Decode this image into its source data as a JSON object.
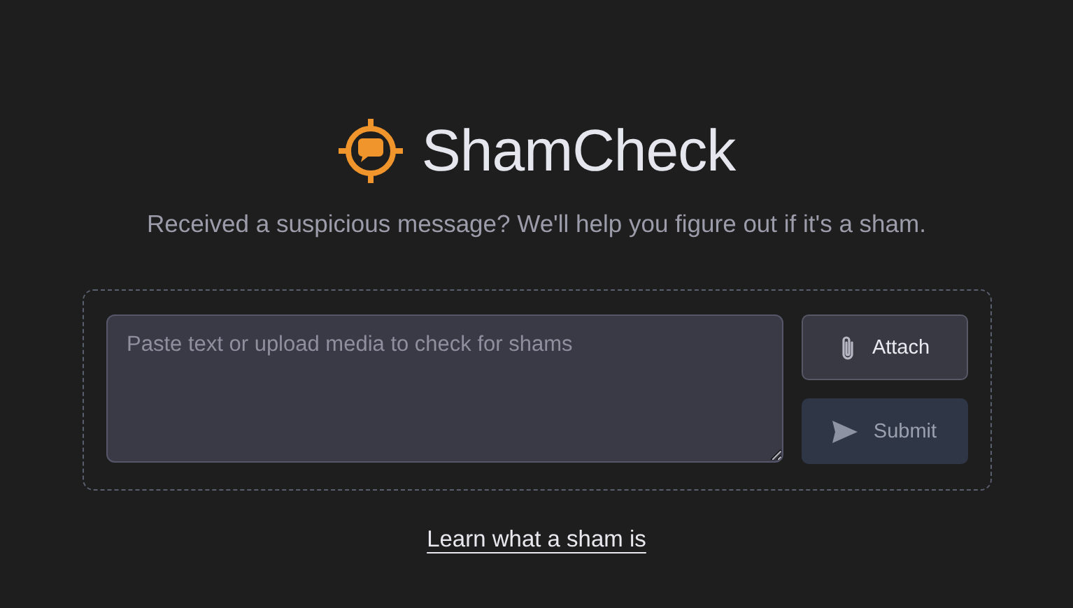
{
  "brand": {
    "name": "ShamCheck"
  },
  "tagline": "Received a suspicious message? We'll help you figure out if it's a sham.",
  "input": {
    "placeholder": "Paste text or upload media to check for shams"
  },
  "buttons": [
    {
      "kind": "attach",
      "label": "Attach",
      "disabled": false
    },
    {
      "kind": "submit",
      "label": "Submit",
      "disabled": true
    }
  ],
  "link": "Learn what a sham is"
}
